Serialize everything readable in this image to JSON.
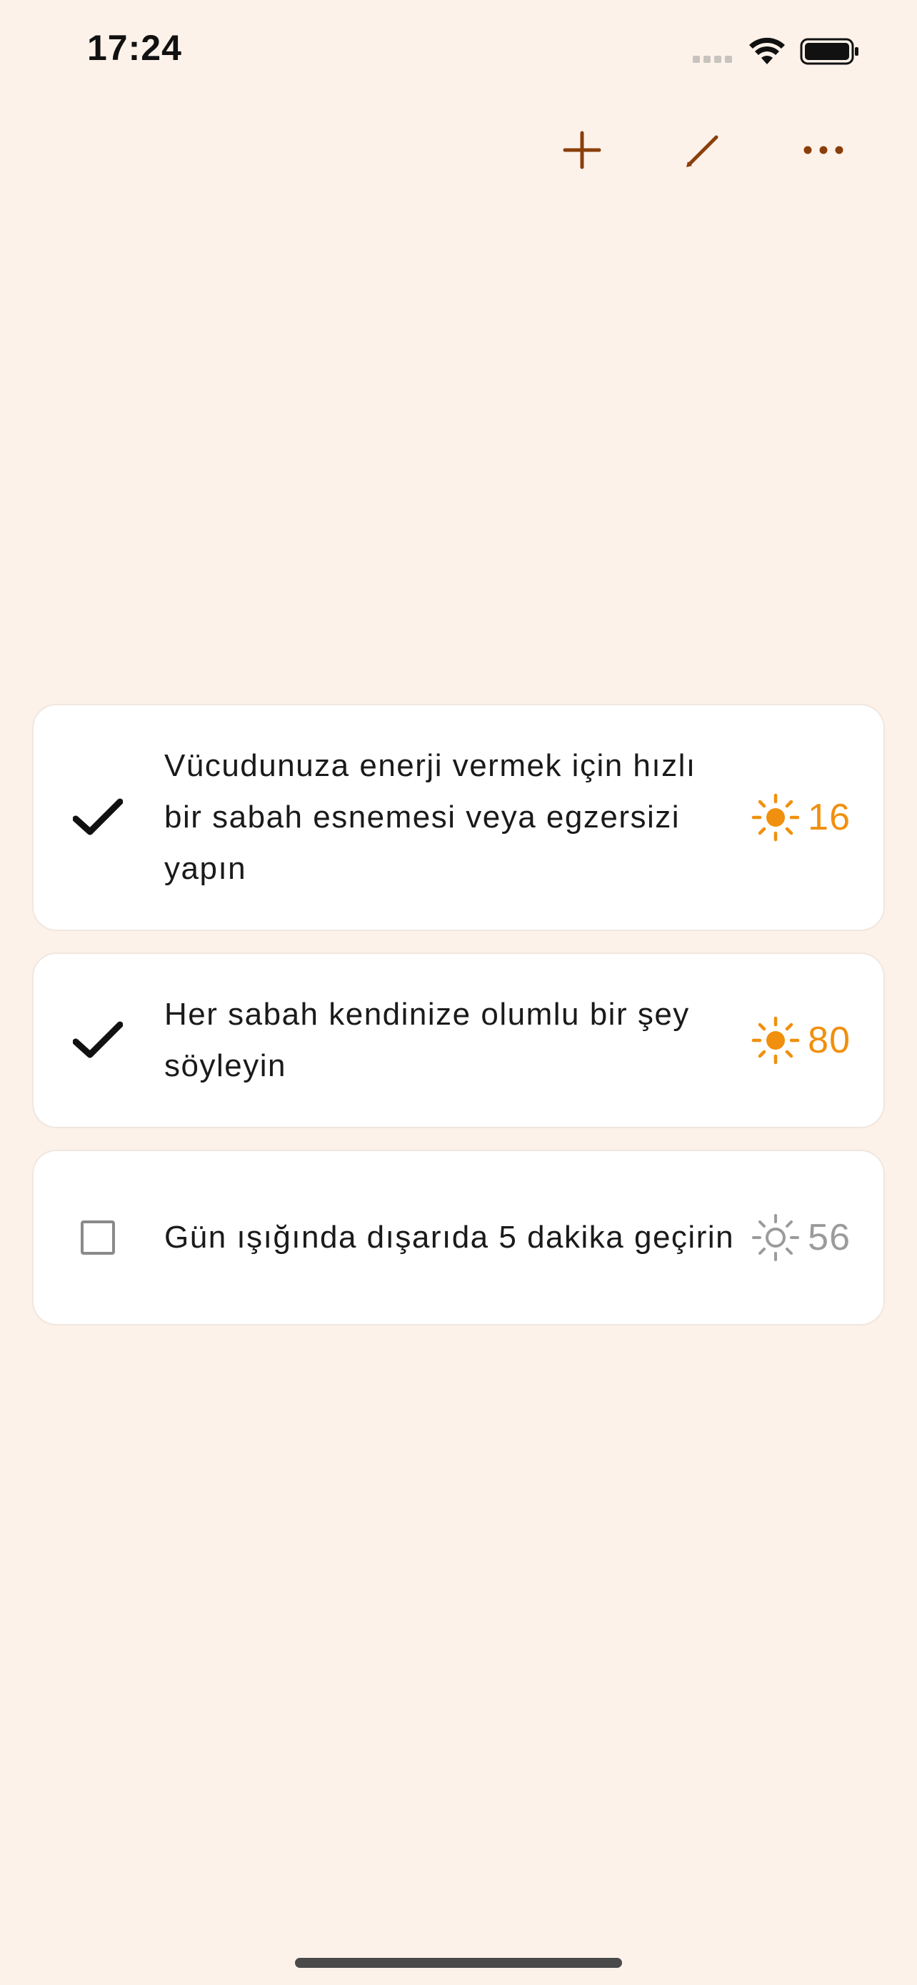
{
  "status_bar": {
    "time": "17:24"
  },
  "toolbar": {
    "add_icon": "plus-icon",
    "edit_icon": "pencil-icon",
    "more_icon": "ellipsis-icon",
    "icon_color": "#8a3f0a"
  },
  "tasks": [
    {
      "text": "Vücudunuza enerji vermek için hızlı bir sabah esnemesi veya egzersizi yapın",
      "completed": true,
      "points": "16",
      "points_icon": "sun-icon"
    },
    {
      "text": "Her sabah kendinize olumlu bir şey söyleyin",
      "completed": true,
      "points": "80",
      "points_icon": "sun-icon"
    },
    {
      "text": "Gün ışığında dışarıda 5 dakika geçirin",
      "completed": false,
      "points": "56",
      "points_icon": "sun-outline-icon"
    }
  ],
  "colors": {
    "background": "#fdf2ea",
    "accent_orange": "#f0900e",
    "inactive_gray": "#9b9b9b",
    "toolbar_brown": "#8a3f0a"
  }
}
